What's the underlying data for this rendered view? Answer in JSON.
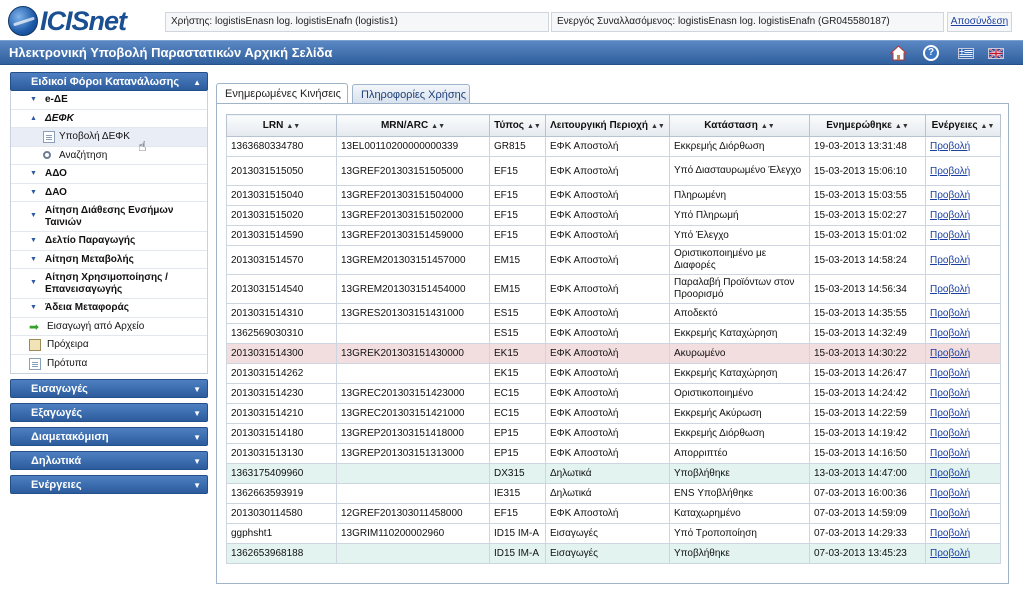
{
  "header": {
    "logo_text": "ICISnet",
    "user_label": "Χρήστης:",
    "user_value": "logistisEnasn log. logistisEnafn (logistis1)",
    "trader_label": "Ενεργός Συναλλασόμενος:",
    "trader_value": "logistisEnasn log. logistisEnafn (GR045580187)",
    "logout": "Αποσύνδεση"
  },
  "titlebar": {
    "title": "Ηλεκτρονική Υποβολή Παραστατικών Αρχική Σελίδα",
    "help_glyph": "?"
  },
  "sidebar": {
    "main_section": "Ειδικοί Φόροι Κατανάλωσης",
    "items": {
      "ede": "e-ΔΕ",
      "defk": "ΔΕΦΚ",
      "defk_submit": "Υποβολή ΔΕΦΚ",
      "search": "Αναζήτηση",
      "ado": "ΑΔΟ",
      "dao": "ΔΑΟ",
      "aitisi_diathesis": "Αίτηση Διάθεσης Ενσήμων Ταινιών",
      "deltio": "Δελτίο Παραγωγής",
      "aitisi_metavolis": "Αίτηση Μεταβολής",
      "aitisi_xrisimopoiisis": "Αίτηση Χρησιμοποίησης / Επανεισαγωγής",
      "adeia": "Άδεια Μεταφοράς",
      "import_file": "Εισαγωγή από Αρχείο",
      "drafts": "Πρόχειρα",
      "templates": "Πρότυπα"
    },
    "sections": [
      "Εισαγωγές",
      "Εξαγωγές",
      "Διαμετακόμιση",
      "Δηλωτικά",
      "Ενέργειες"
    ]
  },
  "tabs": [
    "Ενημερωμένες Κινήσεις",
    "Πληροφορίες Χρήσης"
  ],
  "table": {
    "headers": [
      "LRN",
      "MRN/ARC",
      "Τύπος",
      "Λειτουργική Περιοχή",
      "Κατάσταση",
      "Ενημερώθηκε",
      "Ενέργειες"
    ],
    "rows": [
      [
        "1363680334780",
        "13EL00110200000000339",
        "GR815",
        "ΕΦΚ Αποστολή",
        "Εκκρεμής Διόρθωση",
        "19-03-2013 13:31:48",
        "Προβολή"
      ],
      [
        "2013031515050",
        "13GREF201303151505000",
        "EF15",
        "ΕΦΚ Αποστολή",
        "Υπό Διασταυρωμένο Έλεγχο",
        "15-03-2013 15:06:10",
        "Προβολή"
      ],
      [
        "2013031515040",
        "13GREF201303151504000",
        "EF15",
        "ΕΦΚ Αποστολή",
        "Πληρωμένη",
        "15-03-2013 15:03:55",
        "Προβολή"
      ],
      [
        "2013031515020",
        "13GREF201303151502000",
        "EF15",
        "ΕΦΚ Αποστολή",
        "Υπό Πληρωμή",
        "15-03-2013 15:02:27",
        "Προβολή"
      ],
      [
        "2013031514590",
        "13GREF201303151459000",
        "EF15",
        "ΕΦΚ Αποστολή",
        "Υπό Έλεγχο",
        "15-03-2013 15:01:02",
        "Προβολή"
      ],
      [
        "2013031514570",
        "13GREM201303151457000",
        "EM15",
        "ΕΦΚ Αποστολή",
        "Οριστικοποιημένο με Διαφορές",
        "15-03-2013 14:58:24",
        "Προβολή"
      ],
      [
        "2013031514540",
        "13GREM201303151454000",
        "EM15",
        "ΕΦΚ Αποστολή",
        "Παραλαβή Προϊόντων στον Προορισμό",
        "15-03-2013 14:56:34",
        "Προβολή"
      ],
      [
        "2013031514310",
        "13GRES201303151431000",
        "ES15",
        "ΕΦΚ Αποστολή",
        "Αποδεκτό",
        "15-03-2013 14:35:55",
        "Προβολή"
      ],
      [
        "1362569030310",
        "",
        "ES15",
        "ΕΦΚ Αποστολή",
        "Εκκρεμής Καταχώρηση",
        "15-03-2013 14:32:49",
        "Προβολή"
      ],
      [
        "2013031514300",
        "13GREK201303151430000",
        "EK15",
        "ΕΦΚ Αποστολή",
        "Ακυρωμένο",
        "15-03-2013 14:30:22",
        "Προβολή"
      ],
      [
        "2013031514262",
        "",
        "EK15",
        "ΕΦΚ Αποστολή",
        "Εκκρεμής Καταχώρηση",
        "15-03-2013 14:26:47",
        "Προβολή"
      ],
      [
        "2013031514230",
        "13GREC201303151423000",
        "EC15",
        "ΕΦΚ Αποστολή",
        "Οριστικοποιημένο",
        "15-03-2013 14:24:42",
        "Προβολή"
      ],
      [
        "2013031514210",
        "13GREC201303151421000",
        "EC15",
        "ΕΦΚ Αποστολή",
        "Εκκρεμής Ακύρωση",
        "15-03-2013 14:22:59",
        "Προβολή"
      ],
      [
        "2013031514180",
        "13GREP201303151418000",
        "EP15",
        "ΕΦΚ Αποστολή",
        "Εκκρεμής Διόρθωση",
        "15-03-2013 14:19:42",
        "Προβολή"
      ],
      [
        "2013031513130",
        "13GREP201303151313000",
        "EP15",
        "ΕΦΚ Αποστολή",
        "Απορριπτέο",
        "15-03-2013 14:16:50",
        "Προβολή"
      ],
      [
        "1363175409960",
        "",
        "DX315",
        "Δηλωτικά",
        "Υποβλήθηκε",
        "13-03-2013 14:47:00",
        "Προβολή"
      ],
      [
        "1362663593919",
        "",
        "IE315",
        "Δηλωτικά",
        "ENS Υποβλήθηκε",
        "07-03-2013 16:00:36",
        "Προβολή"
      ],
      [
        "2013030114580",
        "12GREF201303011458000",
        "EF15",
        "ΕΦΚ Αποστολή",
        "Καταχωρημένο",
        "07-03-2013 14:59:09",
        "Προβολή"
      ],
      [
        "ggphsht1",
        "13GRIM110200002960",
        "ID15 IM-A",
        "Εισαγωγές",
        "Υπό Τροποποίηση",
        "07-03-2013 14:29:33",
        "Προβολή"
      ],
      [
        "1362653968188",
        "",
        "ID15 IM-A",
        "Εισαγωγές",
        "Υποβλήθηκε",
        "07-03-2013 13:45:23",
        "Προβολή"
      ]
    ],
    "row_styles": [
      "",
      "tall",
      "",
      "",
      "",
      "tall",
      "tall",
      "",
      "",
      "rejected",
      "",
      "",
      "",
      "",
      "",
      "submitted",
      "",
      "",
      "",
      "submitted"
    ]
  },
  "colors": {
    "accent_blue": "#2f5f9d",
    "link": "#1a3fa0",
    "rejected_row": "#f3dedf",
    "submitted_row": "#e2f3f0"
  }
}
